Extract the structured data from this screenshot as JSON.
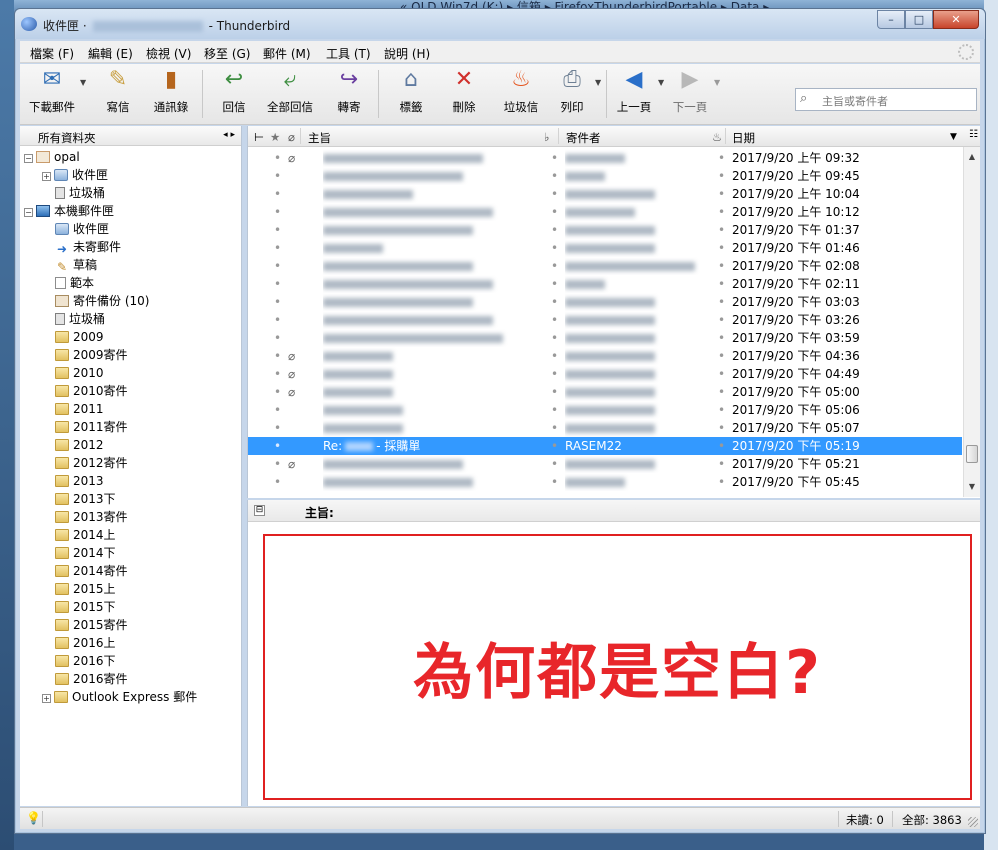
{
  "window": {
    "title_prefix": "收件匣 ·",
    "title_suffix": "- Thunderbird",
    "btn_min": "–",
    "btn_max": "□",
    "btn_close": "✕"
  },
  "background": {
    "explorer_path": "« OLD Win7d (K:) ▸ 信箱 ▸ FirefoxThunderbirdPortable ▸ Data ▸"
  },
  "menu": [
    "檔案 (F)",
    "編輯 (E)",
    "檢視 (V)",
    "移至 (G)",
    "郵件 (M)",
    "工具 (T)",
    "說明 (H)"
  ],
  "toolbar": {
    "get_mail": "下載郵件",
    "write": "寫信",
    "address_book": "通訊錄",
    "reply": "回信",
    "reply_all": "全部回信",
    "forward": "轉寄",
    "tag": "標籤",
    "delete": "刪除",
    "junk": "垃圾信",
    "print": "列印",
    "back": "上一頁",
    "next": "下一頁",
    "search_placeholder": "主旨或寄件者"
  },
  "folders": {
    "header": "所有資料夾",
    "items": [
      {
        "label": "opal",
        "level": 0,
        "twisty": "⊟",
        "icon": "mail"
      },
      {
        "label": "收件匣",
        "level": 1,
        "twisty": "⊞",
        "icon": "inbox"
      },
      {
        "label": "垃圾桶",
        "level": 1,
        "twisty": "",
        "icon": "trash"
      },
      {
        "label": "本機郵件匣",
        "level": 0,
        "twisty": "⊟",
        "icon": "pc"
      },
      {
        "label": "收件匣",
        "level": 1,
        "twisty": "",
        "icon": "inbox"
      },
      {
        "label": "未寄郵件",
        "level": 1,
        "twisty": "",
        "icon": "sym"
      },
      {
        "label": "草稿",
        "level": 1,
        "twisty": "",
        "icon": "sym2"
      },
      {
        "label": "範本",
        "level": 1,
        "twisty": "",
        "icon": "doc"
      },
      {
        "label": "寄件備份 (10)",
        "level": 1,
        "twisty": "",
        "icon": "box"
      },
      {
        "label": "垃圾桶",
        "level": 1,
        "twisty": "",
        "icon": "trash"
      },
      {
        "label": "2009",
        "level": 1,
        "twisty": "",
        "icon": "folder"
      },
      {
        "label": "2009寄件",
        "level": 1,
        "twisty": "",
        "icon": "folder"
      },
      {
        "label": "2010",
        "level": 1,
        "twisty": "",
        "icon": "folder"
      },
      {
        "label": "2010寄件",
        "level": 1,
        "twisty": "",
        "icon": "folder"
      },
      {
        "label": "2011",
        "level": 1,
        "twisty": "",
        "icon": "folder"
      },
      {
        "label": "2011寄件",
        "level": 1,
        "twisty": "",
        "icon": "folder"
      },
      {
        "label": "2012",
        "level": 1,
        "twisty": "",
        "icon": "folder"
      },
      {
        "label": "2012寄件",
        "level": 1,
        "twisty": "",
        "icon": "folder"
      },
      {
        "label": "2013",
        "level": 1,
        "twisty": "",
        "icon": "folder"
      },
      {
        "label": "2013下",
        "level": 1,
        "twisty": "",
        "icon": "folder"
      },
      {
        "label": "2013寄件",
        "level": 1,
        "twisty": "",
        "icon": "folder"
      },
      {
        "label": "2014上",
        "level": 1,
        "twisty": "",
        "icon": "folder"
      },
      {
        "label": "2014下",
        "level": 1,
        "twisty": "",
        "icon": "folder"
      },
      {
        "label": "2014寄件",
        "level": 1,
        "twisty": "",
        "icon": "folder"
      },
      {
        "label": "2015上",
        "level": 1,
        "twisty": "",
        "icon": "folder"
      },
      {
        "label": "2015下",
        "level": 1,
        "twisty": "",
        "icon": "folder"
      },
      {
        "label": "2015寄件",
        "level": 1,
        "twisty": "",
        "icon": "folder"
      },
      {
        "label": "2016上",
        "level": 1,
        "twisty": "",
        "icon": "folder"
      },
      {
        "label": "2016下",
        "level": 1,
        "twisty": "",
        "icon": "folder"
      },
      {
        "label": "2016寄件",
        "level": 1,
        "twisty": "",
        "icon": "folder"
      },
      {
        "label": "Outlook Express 郵件",
        "level": 1,
        "twisty": "⊞",
        "icon": "folder"
      }
    ]
  },
  "message_list": {
    "columns": {
      "subject": "主旨",
      "from": "寄件者",
      "date": "日期"
    },
    "rows": [
      {
        "attach": true,
        "subject": "",
        "from": "",
        "date": "2017/9/20 上午 09:32",
        "selected": false
      },
      {
        "attach": false,
        "subject": "",
        "from": "",
        "date": "2017/9/20 上午 09:45",
        "selected": false
      },
      {
        "attach": false,
        "subject": "",
        "from": "",
        "date": "2017/9/20 上午 10:04",
        "selected": false
      },
      {
        "attach": false,
        "subject": "",
        "from": "",
        "date": "2017/9/20 上午 10:12",
        "selected": false
      },
      {
        "attach": false,
        "subject": "",
        "from": "",
        "date": "2017/9/20 下午 01:37",
        "selected": false
      },
      {
        "attach": false,
        "subject": "",
        "from": "",
        "date": "2017/9/20 下午 01:46",
        "selected": false
      },
      {
        "attach": false,
        "subject": "",
        "from": "",
        "date": "2017/9/20 下午 02:08",
        "selected": false
      },
      {
        "attach": false,
        "subject": "",
        "from": "",
        "date": "2017/9/20 下午 02:11",
        "selected": false
      },
      {
        "attach": false,
        "subject": "",
        "from": "",
        "date": "2017/9/20 下午 03:03",
        "selected": false
      },
      {
        "attach": false,
        "subject": "",
        "from": "",
        "date": "2017/9/20 下午 03:26",
        "selected": false
      },
      {
        "attach": false,
        "subject": "",
        "from": "",
        "date": "2017/9/20 下午 03:59",
        "selected": false
      },
      {
        "attach": true,
        "subject": "",
        "from": "",
        "date": "2017/9/20 下午 04:36",
        "selected": false
      },
      {
        "attach": true,
        "subject": "",
        "from": "",
        "date": "2017/9/20 下午 04:49",
        "selected": false
      },
      {
        "attach": true,
        "subject": "",
        "from": "",
        "date": "2017/9/20 下午 05:00",
        "selected": false
      },
      {
        "attach": false,
        "subject": "",
        "from": "",
        "date": "2017/9/20 下午 05:06",
        "selected": false
      },
      {
        "attach": false,
        "subject": "",
        "from": "",
        "date": "2017/9/20 下午 05:07",
        "selected": false
      },
      {
        "attach": false,
        "subject": "Re:",
        "subject_suffix": "- 採購單",
        "from": "RASEM22",
        "date": "2017/9/20 下午 05:19",
        "selected": true
      },
      {
        "attach": true,
        "subject": "",
        "from": "",
        "date": "2017/9/20 下午 05:21",
        "selected": false
      },
      {
        "attach": false,
        "subject": "",
        "from": "",
        "date": "2017/9/20 下午 05:45",
        "selected": false
      }
    ]
  },
  "preview": {
    "subject_label": "主旨:",
    "annotation": "為何都是空白?"
  },
  "status": {
    "unread": "未讀: 0",
    "total": "全部: 3863"
  },
  "colors": {
    "selection": "#3399ff",
    "annotation_red": "#e8262a"
  }
}
